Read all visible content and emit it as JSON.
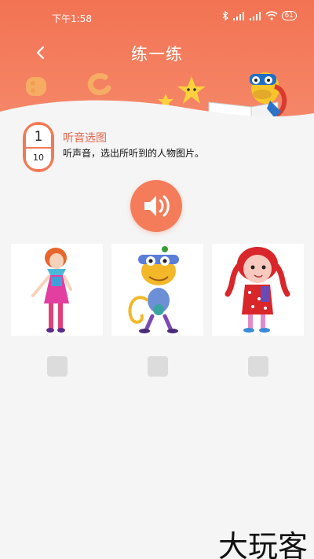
{
  "status_bar": {
    "time": "下午1:58",
    "battery": "61"
  },
  "header": {
    "title": "练一练"
  },
  "question": {
    "current": "1",
    "total": "10",
    "type": "听音选图",
    "instruction": "听声音，选出所听到的人物图片。"
  },
  "options": [
    {
      "name": "girl-in-pink-dress"
    },
    {
      "name": "yellow-monkey-character"
    },
    {
      "name": "red-pigtails-girl"
    }
  ],
  "watermark": "大玩客",
  "colors": {
    "accent": "#f27353",
    "title_text": "#e2674b"
  }
}
